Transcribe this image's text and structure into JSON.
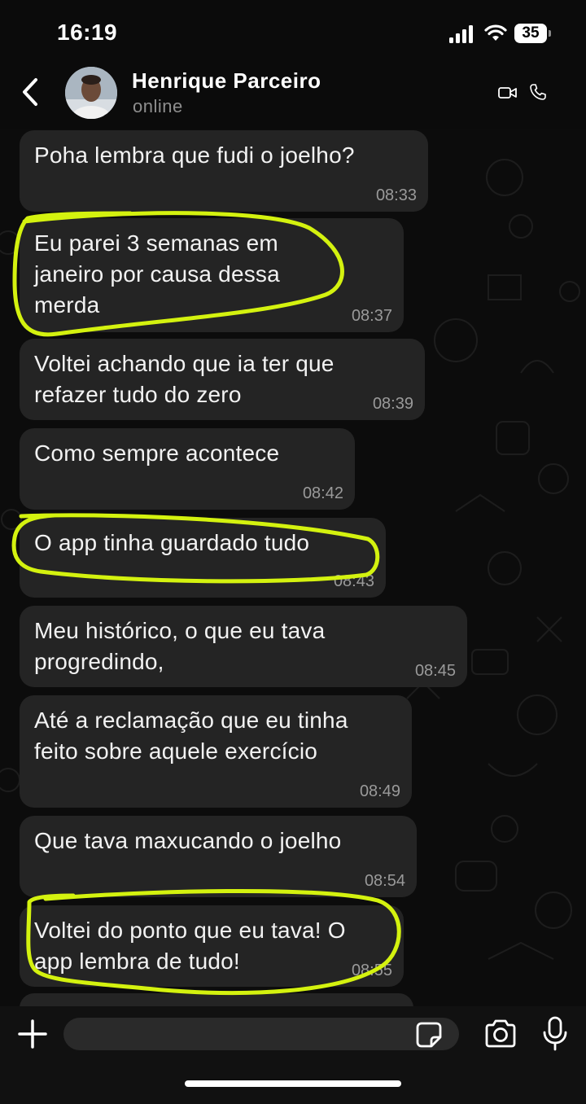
{
  "status_bar": {
    "time": "16:19",
    "battery": "35",
    "icons": [
      "signal-icon",
      "wifi-icon",
      "battery-icon"
    ]
  },
  "header": {
    "contact_name": "Henrique Parceiro",
    "contact_status": "online",
    "icons": [
      "back-chevron-icon",
      "avatar-photo",
      "video-camera-icon",
      "phone-icon"
    ]
  },
  "messages": [
    {
      "text": "Poha lembra que fudi o joelho?",
      "time": "08:33",
      "highlighted": false
    },
    {
      "text": "Eu parei 3 semanas em\njaneiro por causa dessa\nmerda",
      "time": "08:37",
      "highlighted": true
    },
    {
      "text": "Voltei achando que ia ter que\nrefazer tudo do zero",
      "time": "08:39",
      "highlighted": false
    },
    {
      "text": "Como sempre acontece",
      "time": "08:42",
      "highlighted": false
    },
    {
      "text": "O app tinha guardado tudo",
      "time": "08:43",
      "highlighted": true
    },
    {
      "text": "Meu histórico, o que eu tava\nprogredindo,",
      "time": "08:45",
      "highlighted": false
    },
    {
      "text": "Até a reclamação que eu tinha\nfeito sobre aquele exercício",
      "time": "08:49",
      "highlighted": false
    },
    {
      "text": "Que tava maxucando o joelho",
      "time": "08:54",
      "highlighted": false
    },
    {
      "text": "Voltei do ponto que eu tava! O\napp lembra de tudo!",
      "time": "08:55",
      "highlighted": true
    }
  ],
  "highlight_color": "#d4f20f",
  "bubble_color": "#242424",
  "input_bar": {
    "placeholder": "",
    "icons": [
      "plus-icon",
      "sticker-icon",
      "camera-icon",
      "microphone-icon"
    ]
  }
}
